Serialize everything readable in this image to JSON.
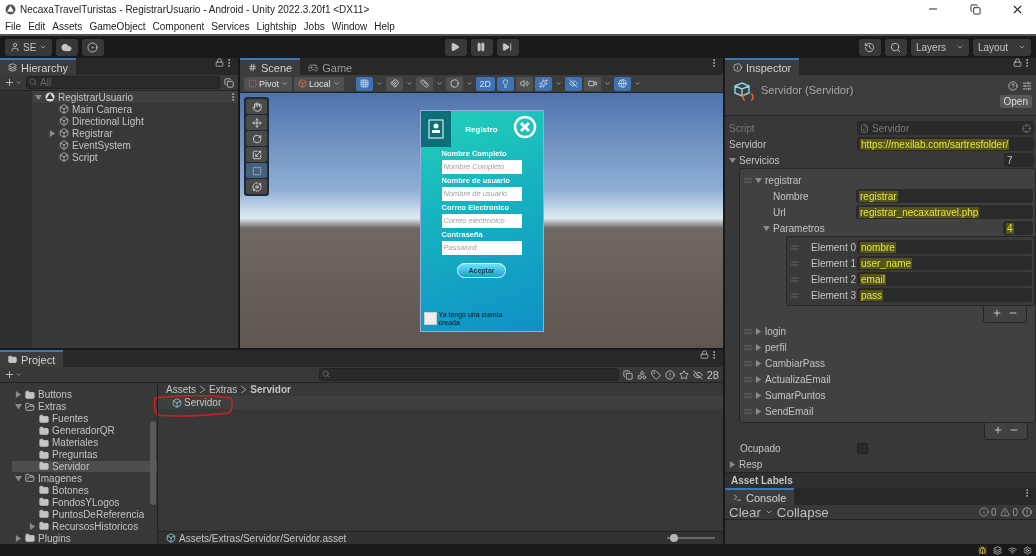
{
  "window": {
    "title": "NecaxaTravelTuristas - RegistrarUsuario - Android - Unity 2022.3.20f1 <DX11>"
  },
  "menu": [
    "File",
    "Edit",
    "Assets",
    "GameObject",
    "Component",
    "Services",
    "Lightship",
    "Jobs",
    "Window",
    "Help"
  ],
  "toolbar": {
    "account": "SE",
    "layers": "Layers",
    "layout": "Layout"
  },
  "hierarchy": {
    "title": "Hierarchy",
    "search_placeholder": "All",
    "tree": [
      {
        "label": "RegistrarUsuario",
        "kind": "scene",
        "expanded": true,
        "children": [
          {
            "label": "Main Camera",
            "kind": "object"
          },
          {
            "label": "Directional Light",
            "kind": "object"
          },
          {
            "label": "Registrar",
            "kind": "object",
            "expanded": false
          },
          {
            "label": "EventSystem",
            "kind": "object"
          },
          {
            "label": "Script",
            "kind": "object"
          }
        ]
      }
    ]
  },
  "scene": {
    "tabs": [
      {
        "label": "Scene",
        "kind": "scene",
        "selected": true
      },
      {
        "label": "Game",
        "kind": "game",
        "selected": false
      }
    ],
    "pivot": "Pivot",
    "space": "Local",
    "toggles": [
      {
        "kind": "grid",
        "on": true
      },
      {
        "kind": "snap",
        "on": false
      },
      {
        "kind": "increment",
        "on": false
      },
      {
        "kind": "draw",
        "on": false
      },
      {
        "kind": "dimension",
        "label": "2D",
        "on": true
      },
      {
        "kind": "lighting",
        "on": true
      },
      {
        "kind": "audio",
        "on": false
      },
      {
        "kind": "effects",
        "on": true
      },
      {
        "kind": "visibility",
        "on": true
      },
      {
        "kind": "camera",
        "on": false
      },
      {
        "kind": "gizmos",
        "on": true
      }
    ],
    "tools": [
      {
        "kind": "hand",
        "selected": false
      },
      {
        "kind": "move",
        "selected": false
      },
      {
        "kind": "rotate",
        "selected": false
      },
      {
        "kind": "scale",
        "selected": false
      },
      {
        "kind": "rect",
        "selected": true
      },
      {
        "kind": "transform",
        "selected": false
      }
    ]
  },
  "form": {
    "title": "Registro",
    "fields": [
      {
        "label": "Nombre Completo",
        "placeholder": "Nombre Completo"
      },
      {
        "label": "Nombre de usuario",
        "placeholder": "Nombre de usuario"
      },
      {
        "label": "Correo Electronico",
        "placeholder": "Correo electronico"
      },
      {
        "label": "Contraseña",
        "placeholder": "Password"
      }
    ],
    "button": "Aceptar",
    "checkbox_label": "Ya tengo una cuenta creada",
    "checked": false
  },
  "project": {
    "title": "Project",
    "hidden_count": "28",
    "tree": [
      {
        "label": "Buttons",
        "expanded": false,
        "selected": false
      },
      {
        "label": "Extras",
        "expanded": true,
        "selected": false,
        "children": [
          {
            "label": "Fuentes",
            "selected": false
          },
          {
            "label": "GeneradorQR",
            "selected": false
          },
          {
            "label": "Materiales",
            "selected": false
          },
          {
            "label": "Preguntas",
            "selected": false
          },
          {
            "label": "Servidor",
            "selected": true
          }
        ]
      },
      {
        "label": "Imagenes",
        "expanded": true,
        "selected": false,
        "children": [
          {
            "label": "Botones",
            "selected": false
          },
          {
            "label": "FondosYLogos",
            "selected": false
          },
          {
            "label": "PuntosDeReferencia",
            "selected": false
          },
          {
            "label": "RecursosHistoricos",
            "expanded": false,
            "selected": false
          }
        ]
      },
      {
        "label": "Plugins",
        "expanded": false,
        "selected": false
      }
    ],
    "breadcrumb": [
      "Assets",
      "Extras",
      "Servidor"
    ],
    "assets": [
      {
        "name": "Servidor"
      }
    ],
    "path": "Assets/Extras/Servidor/Servidor.asset",
    "zoom": {
      "level": 0.15
    }
  },
  "inspector": {
    "title": "Inspector",
    "object": "Servidor (Servidor)",
    "open_button": "Open",
    "script": {
      "label": "Script",
      "value": "Servidor"
    },
    "servidor": {
      "label": "Servidor",
      "value": "https://mexilab.com/sartresfolder/",
      "highlighted": true
    },
    "servicios": {
      "label": "Servicios",
      "count": "7",
      "expanded": true,
      "items": [
        {
          "name": "registrar",
          "expanded": true,
          "fields": [
            {
              "label": "Nombre",
              "value": "registrar",
              "highlighted": true
            },
            {
              "label": "Url",
              "value": "registrar_necaxatravel.php",
              "highlighted": true
            }
          ],
          "parametros": {
            "label": "Parametros",
            "count": "4",
            "count_highlighted": true,
            "expanded": true,
            "elements": [
              {
                "label": "Element 0",
                "value": "nombre",
                "highlighted": true
              },
              {
                "label": "Element 1",
                "value": "user_name",
                "highlighted": true
              },
              {
                "label": "Element 2",
                "value": "email",
                "highlighted": true
              },
              {
                "label": "Element 3",
                "value": "pass",
                "highlighted": true
              }
            ]
          }
        },
        {
          "name": "login",
          "expanded": false
        },
        {
          "name": "perfil",
          "expanded": false
        },
        {
          "name": "CambiarPass",
          "expanded": false
        },
        {
          "name": "ActualizaEmail",
          "expanded": false
        },
        {
          "name": "SumarPuntos",
          "expanded": false
        },
        {
          "name": "SendEmail",
          "expanded": false
        }
      ]
    },
    "ocupado": {
      "label": "Ocupado",
      "checked": false
    },
    "resp": {
      "label": "Resp",
      "expanded": false
    },
    "asset_labels": "Asset Labels"
  },
  "console": {
    "title": "Console",
    "clear": "Clear",
    "collapse": "Collapse",
    "counts": [
      "0",
      "0"
    ]
  }
}
